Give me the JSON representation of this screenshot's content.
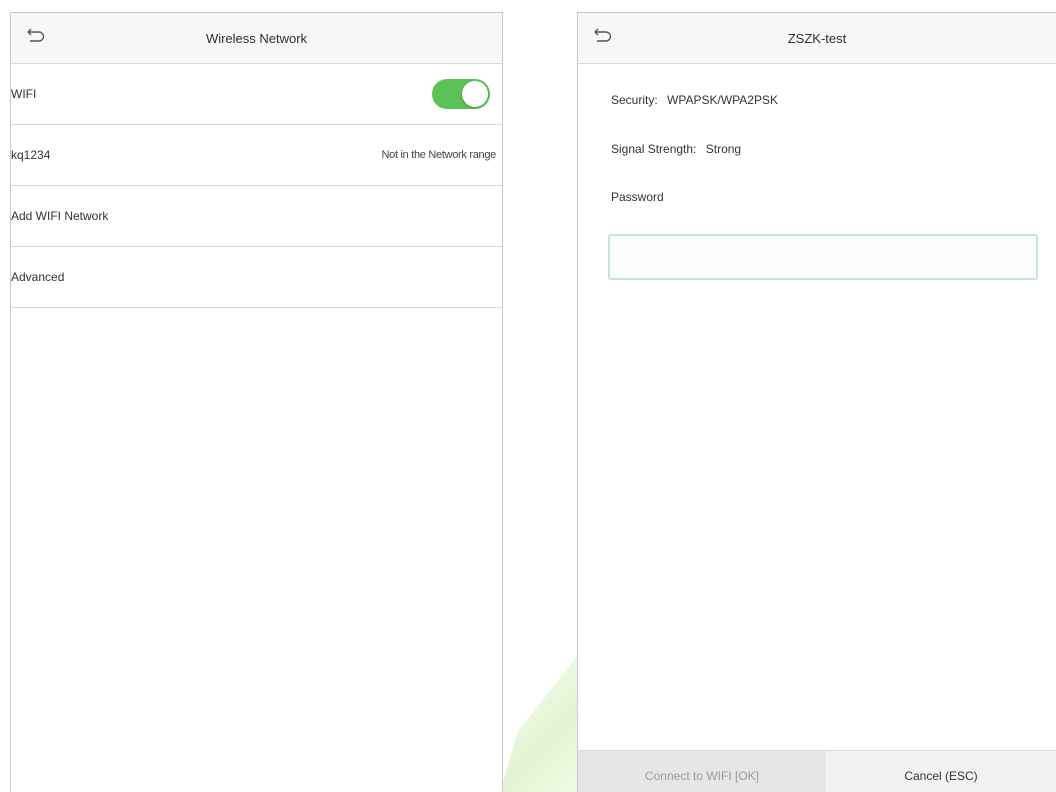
{
  "left": {
    "title": "Wireless Network",
    "rows": [
      {
        "label": "WIFI",
        "value": ""
      },
      {
        "label": "kq1234",
        "value": "Not in the Network range"
      },
      {
        "label": "Add WIFI Network",
        "value": ""
      },
      {
        "label": "Advanced",
        "value": ""
      }
    ],
    "wifi_enabled": true
  },
  "right": {
    "title": "ZSZK-test",
    "security_label": "Security:",
    "security_value": "WPAPSK/WPA2PSK",
    "signal_label": "Signal Strength:",
    "signal_value": "Strong",
    "password_label": "Password",
    "password_value": "",
    "connect_label": "Connect to WIFI [OK]",
    "cancel_label": "Cancel (ESC)"
  },
  "icons": {
    "back": "back-arrow-icon"
  },
  "colors": {
    "toggle_on": "#5cc257",
    "field_border": "#c7e1dc"
  }
}
